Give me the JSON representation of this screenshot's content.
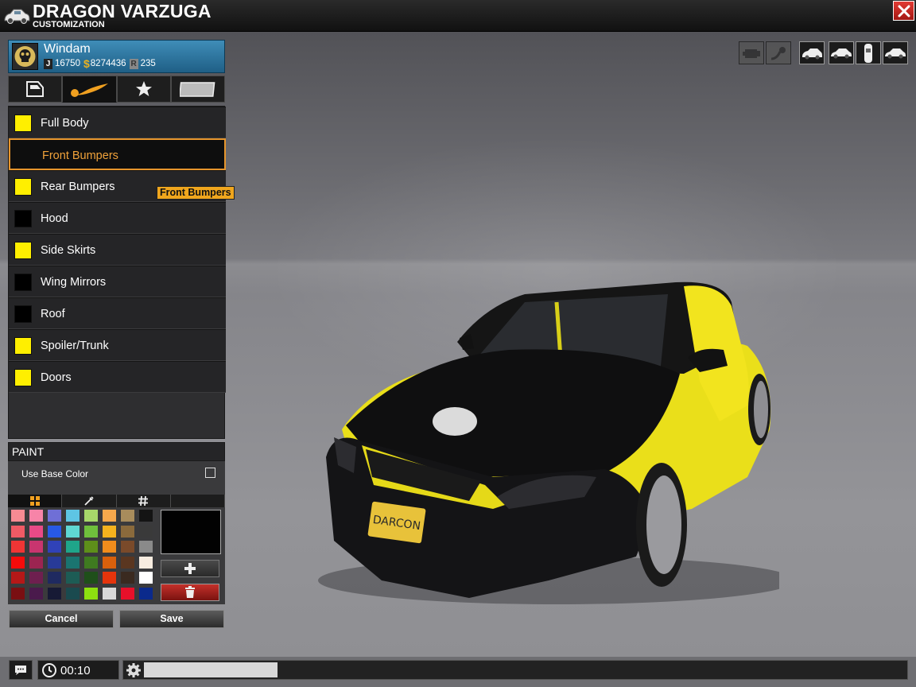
{
  "window": {
    "title": "DRAGON VARZUGA",
    "subtitle": "CUSTOMIZATION",
    "close_icon": "close-icon"
  },
  "player": {
    "name": "Windam",
    "stats": [
      {
        "icon": "J",
        "value": "16750"
      },
      {
        "icon": "$",
        "value": "8274436"
      },
      {
        "icon": "R",
        "value": "235"
      }
    ]
  },
  "tabs": [
    {
      "name": "parts-tab",
      "icon": "car-door-icon",
      "active": false
    },
    {
      "name": "paint-tab",
      "icon": "paint-brush-icon",
      "active": true
    },
    {
      "name": "decals-tab",
      "icon": "star-icon",
      "active": false
    },
    {
      "name": "plate-tab",
      "icon": "license-plate-icon",
      "active": false
    }
  ],
  "parts": [
    {
      "label": "Full Body",
      "color": "#ffef00",
      "selected": false
    },
    {
      "label": "Front Bumpers",
      "color": null,
      "selected": true
    },
    {
      "label": "Rear Bumpers",
      "color": "#ffef00",
      "selected": false
    },
    {
      "label": "Hood",
      "color": "#000000",
      "selected": false
    },
    {
      "label": "Side Skirts",
      "color": "#ffef00",
      "selected": false
    },
    {
      "label": "Wing Mirrors",
      "color": "#000000",
      "selected": false
    },
    {
      "label": "Roof",
      "color": "#000000",
      "selected": false
    },
    {
      "label": "Spoiler/Trunk",
      "color": "#ffef00",
      "selected": false
    },
    {
      "label": "Doors",
      "color": "#ffef00",
      "selected": false
    }
  ],
  "tooltip": "Front Bumpers",
  "paint": {
    "header": "PAINT",
    "use_base_color_label": "Use Base Color",
    "use_base_color_checked": false,
    "tabs": [
      "swatches-grid-icon",
      "eyedropper-icon",
      "hash-icon",
      ""
    ],
    "palette": [
      [
        "#f78b93",
        "#f784a8",
        "#6f6fd6",
        "#5ec5e4",
        "#a8d86a",
        "#f7a84c",
        "#a88c5c",
        "#141414"
      ],
      [
        "#f05a65",
        "#e84a87",
        "#2859e6",
        "#5fd7d3",
        "#6fbf3c",
        "#f5b21e",
        "#8a6a3c",
        "#3a3a3a"
      ],
      [
        "#f03535",
        "#c8356f",
        "#3042b8",
        "#1fa58a",
        "#5e8f1a",
        "#f08c1c",
        "#7a4a2a",
        "#8a8a8a"
      ],
      [
        "#f50b0b",
        "#9c2451",
        "#283a98",
        "#1a7470",
        "#3f7a20",
        "#d8600c",
        "#5a3620",
        "#f7ece0"
      ],
      [
        "#b51818",
        "#6e1f4f",
        "#1f2a60",
        "#1d5c55",
        "#1f4f1a",
        "#e5340c",
        "#3a2a20",
        "#ffffff"
      ],
      [
        "#7a0f12",
        "#4a1a4c",
        "#171a35",
        "#1a4a4f",
        "#8de010",
        "#d8d8d8",
        "#e8102a",
        "#0b2a8c"
      ]
    ],
    "preview_color": "#020202",
    "add_icon": "plus-icon",
    "delete_icon": "trash-icon"
  },
  "buttons": {
    "cancel": "Cancel",
    "save": "Save"
  },
  "camera_toolbar": [
    {
      "name": "engine-view-button",
      "icon": "engine-icon",
      "enabled": false
    },
    {
      "name": "exhaust-view-button",
      "icon": "exhaust-icon",
      "enabled": false
    },
    {
      "name": "front-three-quarter-view-button",
      "icon": "car-front-icon",
      "enabled": true
    },
    {
      "name": "side-view-button",
      "icon": "car-side-icon",
      "enabled": true
    },
    {
      "name": "top-view-button",
      "icon": "car-top-icon",
      "enabled": true
    },
    {
      "name": "rear-view-button",
      "icon": "car-rear-icon",
      "enabled": true
    }
  ],
  "car": {
    "plate_text": "DARCON",
    "body_color": "#f0e21c",
    "hood_color": "#0f0f10"
  },
  "bottom": {
    "chat_icon": "chat-icon",
    "clock_icon": "clock-icon",
    "time": "00:10",
    "progress": 0.17
  }
}
